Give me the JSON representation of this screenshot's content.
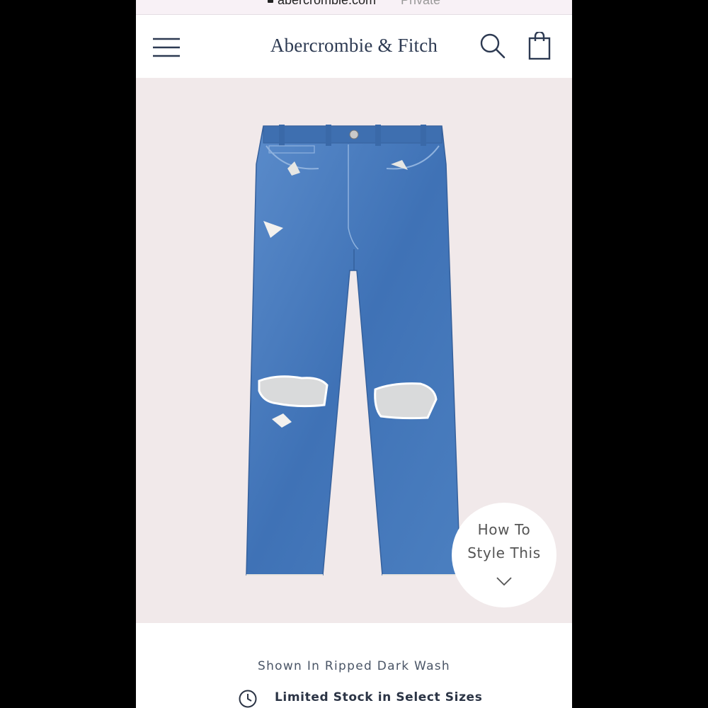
{
  "browser": {
    "url": "abercrombie.com",
    "mode_label": "Private"
  },
  "header": {
    "brand": "Abercrombie & Fitch",
    "icons": [
      "menu-icon",
      "search-icon",
      "shopping-bag-icon"
    ]
  },
  "product": {
    "image_alt": "ripped-straight-jeans",
    "style_button": {
      "line1": "How To",
      "line2": "Style This",
      "icon": "chevron-down-icon"
    },
    "shown_in": "Shown In Ripped Dark Wash",
    "stock": {
      "icon": "clock-icon",
      "text": "Limited Stock in Select Sizes"
    }
  },
  "colors": {
    "brand_navy": "#2d3a52",
    "image_bg": "#f1e9ea",
    "denim": "#4a7bbd"
  }
}
